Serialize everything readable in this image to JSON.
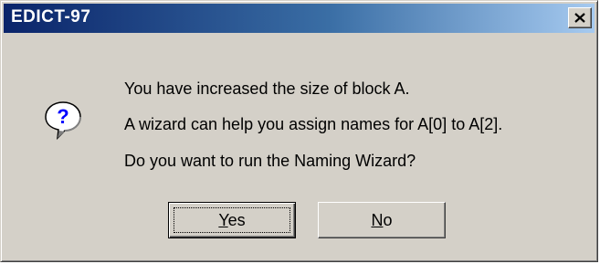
{
  "window": {
    "title": "EDICT-97",
    "close_icon": "close-x-icon"
  },
  "message": {
    "icon": "question-balloon-icon",
    "line1": "You have increased the size of block A.",
    "line2": "A wizard can help you assign names for A[0] to A[2].",
    "line3": "Do you want to run the Naming Wizard?"
  },
  "buttons": {
    "yes_mnemonic": "Y",
    "yes_rest": "es",
    "no_mnemonic": "N",
    "no_rest": "o",
    "default": "Yes"
  },
  "colors": {
    "dialog_face": "#d4d0c8",
    "title_start": "#0a246a",
    "title_end": "#a6caf0",
    "title_text": "#ffffff"
  }
}
